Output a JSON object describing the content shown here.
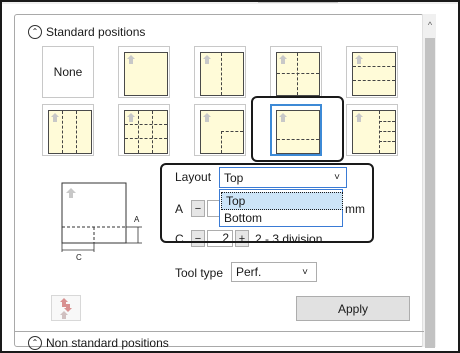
{
  "sections": {
    "standard_label": "Standard positions",
    "nonstandard_label": "Non standard positions"
  },
  "tiles": {
    "none_label": "None"
  },
  "layout": {
    "label": "Layout",
    "selected": "Top",
    "options": [
      "Top",
      "Bottom"
    ]
  },
  "fields": {
    "a_label": "A",
    "a_unit": "mm",
    "minus": "−",
    "plus": "+",
    "c_label": "C",
    "c_value": "2",
    "c_suffix": "2 - 3 division"
  },
  "preview": {
    "dim_a": "A",
    "dim_c": "C"
  },
  "tool_type": {
    "label": "Tool type",
    "value": "Perf."
  },
  "apply_label": "Apply",
  "icons": {
    "chevron_up": "⌃",
    "dropdown": "˅",
    "scroll_up": "^"
  }
}
